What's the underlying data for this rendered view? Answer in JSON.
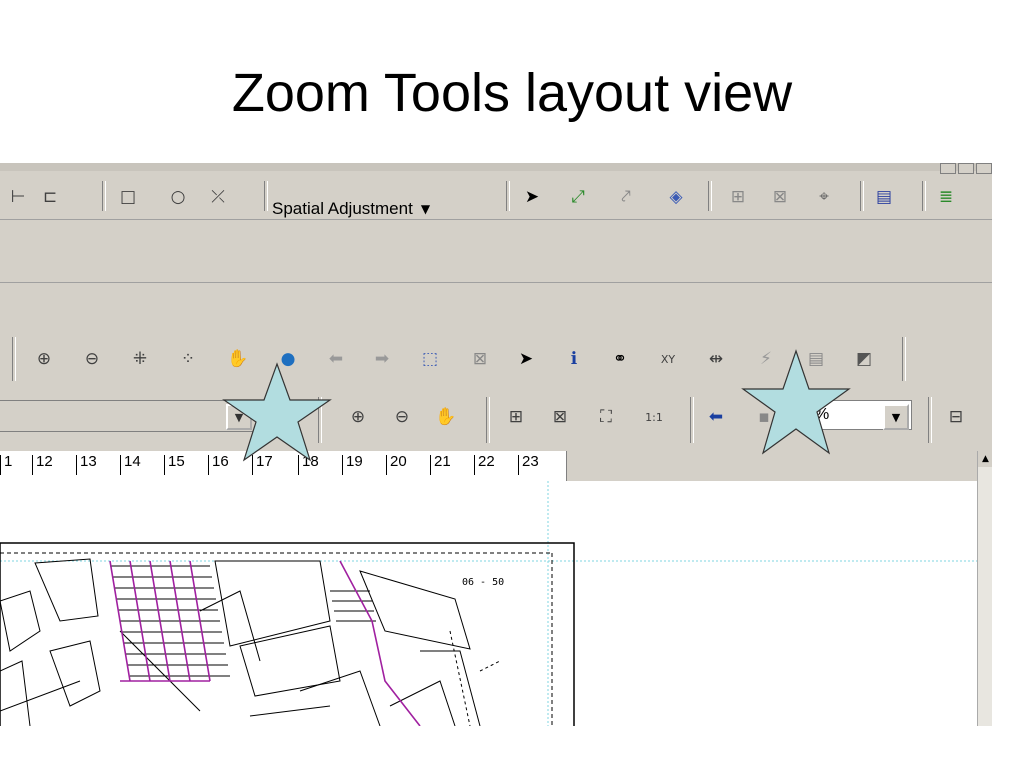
{
  "slide": {
    "title": "Zoom Tools layout view"
  },
  "toolbar1": {
    "spatial_adjustment_label": "Spatial Adjustment",
    "icons": [
      "edit-vertex-icon",
      "reshape-icon",
      "rectangle-icon",
      "circle-icon",
      "line-icon",
      "select-pointer-icon",
      "new-link-icon",
      "new-displacement-icon",
      "adjust-icon",
      "view-table-icon",
      "view-limited-icon",
      "new-identity-link-icon",
      "link-table-icon",
      "preview-icon"
    ]
  },
  "toolbar2": {
    "icons": [
      "zoom-in-icon",
      "zoom-out-icon",
      "fixed-zoom-in-icon",
      "fixed-zoom-out-icon",
      "pan-icon",
      "full-extent-icon",
      "back-icon",
      "forward-icon",
      "select-features-icon",
      "clear-selection-icon",
      "select-elements-icon",
      "identify-icon",
      "find-icon",
      "go-to-xy-icon",
      "measure-icon",
      "hyperlink-icon",
      "html-popup-icon",
      "time-slider-icon"
    ]
  },
  "layout_toolbar": {
    "zoom_percent": "%",
    "icons": [
      "layout-zoom-in-icon",
      "layout-zoom-out-icon",
      "layout-pan-icon",
      "zoom-whole-page-icon",
      "zoom-to-100-icon",
      "fixed-zoom-icon",
      "actual-size-icon",
      "go-back-extent-icon",
      "toggle-draft-mode-icon",
      "focus-data-frame-icon"
    ]
  },
  "ruler": {
    "ticks": [
      "1",
      "12",
      "13",
      "14",
      "15",
      "16",
      "17",
      "18",
      "19",
      "20",
      "21",
      "22",
      "23"
    ]
  },
  "map": {
    "stamp": "06 - 50"
  },
  "colors": {
    "chrome": "#d4d0c8",
    "guide": "#7fd6e0",
    "highlight_star": "#b2dde0",
    "parcel_road": "#a020a0"
  }
}
